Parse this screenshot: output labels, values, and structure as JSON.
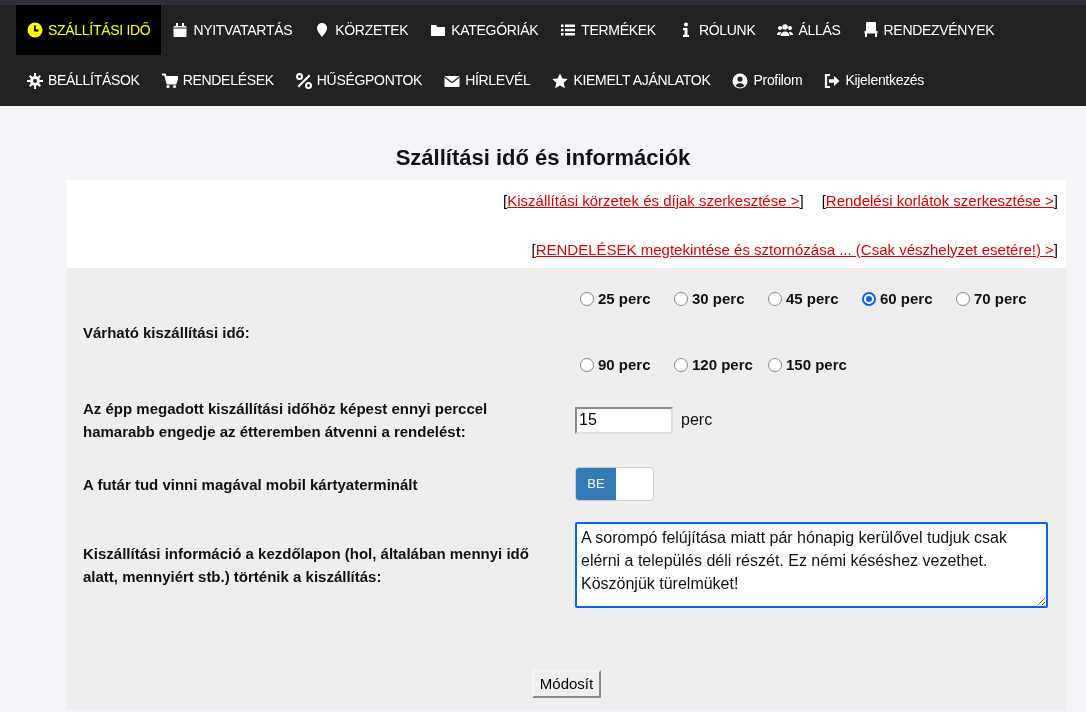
{
  "nav": {
    "rows": [
      [
        {
          "label": "SZÁLLÍTÁSI IDŐ",
          "selected": true
        },
        {
          "label": "NYITVATARTÁS",
          "selected": false
        },
        {
          "label": "KÖRZETEK",
          "selected": false
        },
        {
          "label": "KATEGÓRIÁK",
          "selected": false
        },
        {
          "label": "TERMÉKEK",
          "selected": false
        },
        {
          "label": "RÓLUNK",
          "selected": false
        },
        {
          "label": "ÁLLÁS",
          "selected": false
        },
        {
          "label": "RENDEZVÉNYEK",
          "selected": false
        }
      ],
      [
        {
          "label": "BEÁLLÍTÁSOK",
          "selected": false
        },
        {
          "label": "RENDELÉSEK",
          "selected": false
        },
        {
          "label": "HŰSÉGPONTOK",
          "selected": false
        },
        {
          "label": "HÍRLEVÉL",
          "selected": false
        },
        {
          "label": "KIEMELT AJÁNLATOK",
          "selected": false
        },
        {
          "label": "Profilom",
          "selected": false
        },
        {
          "label": "Kijelentkezés",
          "selected": false
        }
      ]
    ]
  },
  "title": "Szállítási idő és információk",
  "link_rows": [
    [
      {
        "open": "[",
        "label": "Kiszállítási körzetek és díjak szerkesztése >",
        "close": "]"
      },
      {
        "open": "[",
        "label": "Rendelési korlátok szerkesztése >",
        "close": "]"
      }
    ],
    [
      {
        "open": "[",
        "label": "RENDELÉSEK megtekintése és sztornózása ... (Csak vészhelyzet esetére!) >",
        "close": "]"
      }
    ]
  ],
  "form": {
    "delivery_time": {
      "label": "Várható kiszállítási idő:",
      "options": [
        {
          "label": "25 perc",
          "selected": false
        },
        {
          "label": "30 perc",
          "selected": false
        },
        {
          "label": "45 perc",
          "selected": false
        },
        {
          "label": "60 perc",
          "selected": true
        },
        {
          "label": "70 perc",
          "selected": false
        },
        {
          "label": "90 perc",
          "selected": false
        },
        {
          "label": "120 perc",
          "selected": false
        },
        {
          "label": "150 perc",
          "selected": false
        }
      ]
    },
    "pickup_earlier": {
      "label": "Az épp megadott kiszállítási időhöz képest ennyi perccel hamarabb engedje az étteremben átvenni a rendelést:",
      "value": "15",
      "unit": "perc"
    },
    "card_terminal": {
      "label": "A futár tud vinni magával mobil kártyaterminált",
      "on": true,
      "on_label": "BE"
    },
    "delivery_info": {
      "label": "Kiszállítási információ a kezdőlapon (hol, általában mennyi idő alatt, mennyiért stb.) történik a kiszállítás:",
      "value": "A sorompó felújítása miatt pár hónapig kerülővel tudjuk csak elérni a település déli részét. Ez némi késéshez vezethet. Köszönjük türelmüket!"
    },
    "submit": "Módosít"
  }
}
